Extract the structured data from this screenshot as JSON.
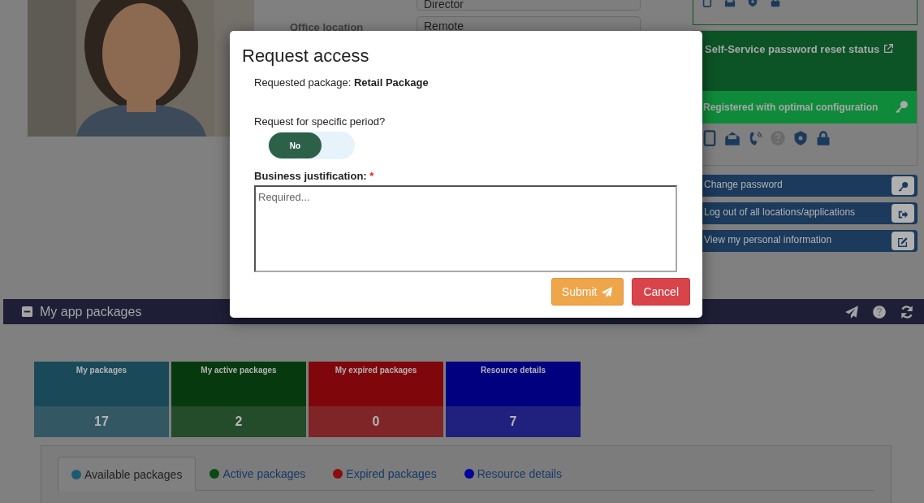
{
  "profile": {
    "fields": [
      {
        "value": "Director"
      },
      {
        "label": "Office location",
        "value": "Remote"
      }
    ]
  },
  "sspr_panel": {
    "title": "Self-Service password reset status",
    "status": "Registered with optimal configuration"
  },
  "actions": [
    {
      "label": "Change password"
    },
    {
      "label": "Log out of all locations/applications"
    },
    {
      "label": "View my personal information"
    }
  ],
  "section": {
    "title": "My app packages"
  },
  "tiles": [
    {
      "title": "My packages",
      "count": "17",
      "color": "#1a4a5a"
    },
    {
      "title": "My active packages",
      "count": "2",
      "color": "#063a0e"
    },
    {
      "title": "My expired packages",
      "count": "0",
      "color": "#7f070b"
    },
    {
      "title": "Resource details",
      "count": "7",
      "color": "#01017f"
    }
  ],
  "tabs": [
    {
      "label": "Available packages",
      "selected": true,
      "color": "#1c5a70"
    },
    {
      "label": "Active packages",
      "selected": false,
      "color": "#0b4a12"
    },
    {
      "label": "Expired packages",
      "selected": false,
      "color": "#8a0e10"
    },
    {
      "label": "Resource details",
      "selected": false,
      "color": "#02029a"
    }
  ],
  "dialog": {
    "title": "Request access",
    "package_label": "Requested package:",
    "package_name": "Retail Package",
    "period_question": "Request for specific period?",
    "period_toggle": {
      "label": "No",
      "on": false
    },
    "justification_label": "Business justification:",
    "required_mark": "*",
    "placeholder": "Required...",
    "buttons": [
      {
        "label": "Submit",
        "kind": "primary"
      },
      {
        "label": "Cancel",
        "kind": "cancel"
      }
    ]
  }
}
